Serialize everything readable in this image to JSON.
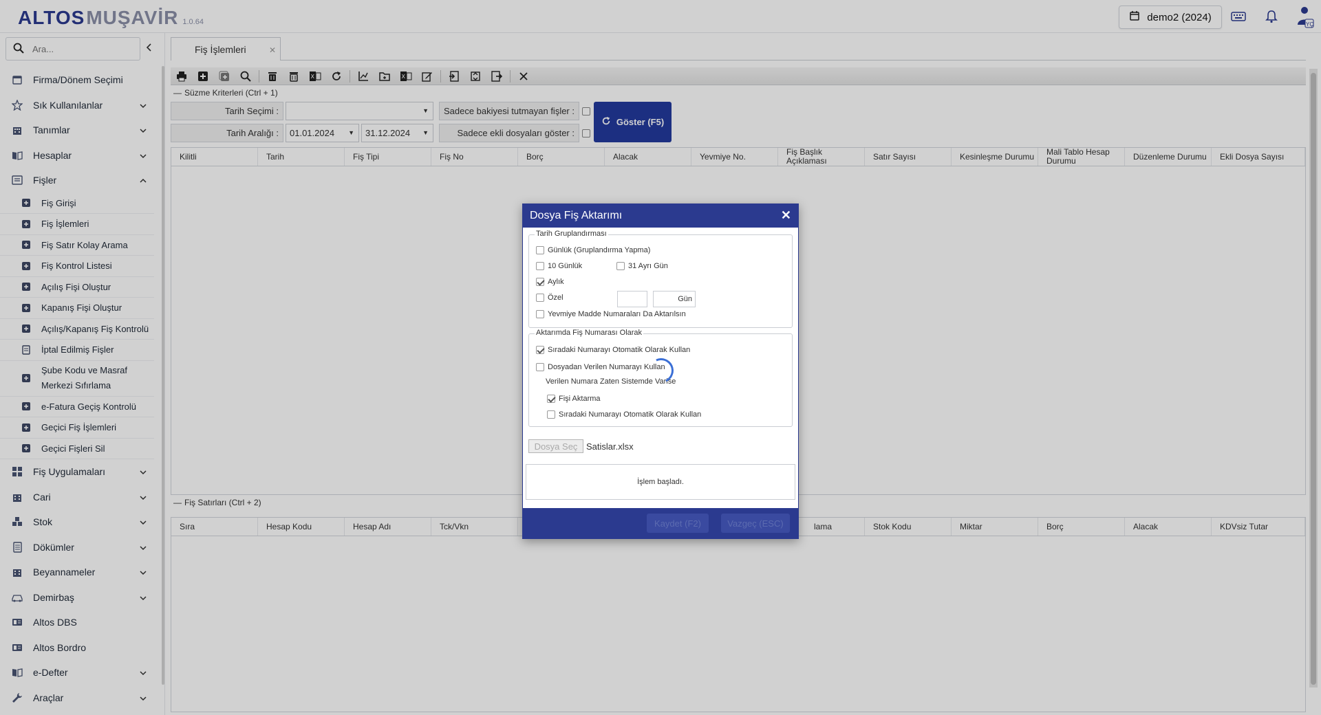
{
  "app": {
    "logo_part1": "ALTOS",
    "logo_part2": "MUŞAVİR",
    "version": "1.0.64",
    "company": "demo2 (2024)",
    "user_initials": "YÇ"
  },
  "sidebar": {
    "search_placeholder": "Ara...",
    "items": [
      {
        "label": "Firma/Dönem Seçimi",
        "icon": "calendar-icon"
      },
      {
        "label": "Sık Kullanılanlar",
        "icon": "star-icon"
      },
      {
        "label": "Tanımlar",
        "icon": "building-icon"
      },
      {
        "label": "Hesaplar",
        "icon": "book-icon"
      },
      {
        "label": "Fişler",
        "icon": "list-icon"
      }
    ],
    "sub_items": [
      "Fiş Girişi",
      "Fiş İşlemleri",
      "Fiş Satır Kolay Arama",
      "Fiş Kontrol Listesi",
      "Açılış Fişi Oluştur",
      "Kapanış Fişi Oluştur",
      "Açılış/Kapanış Fiş Kontrolü",
      "İptal Edilmiş Fişler",
      "Şube Kodu ve Masraf Merkezi Sıfırlama",
      "e-Fatura Geçiş Kontrolü",
      "Geçici Fiş İşlemleri",
      "Geçici Fişleri Sil"
    ],
    "bottom_items": [
      {
        "label": "Fiş Uygulamaları",
        "icon": "grid-icon",
        "chevron": true
      },
      {
        "label": "Cari",
        "icon": "building-icon",
        "chevron": true
      },
      {
        "label": "Stok",
        "icon": "boxes-icon",
        "chevron": true
      },
      {
        "label": "Dökümler",
        "icon": "document-icon",
        "chevron": true
      },
      {
        "label": "Beyannameler",
        "icon": "building-icon",
        "chevron": true
      },
      {
        "label": "Demirbaş",
        "icon": "car-icon",
        "chevron": true
      },
      {
        "label": "Altos DBS",
        "icon": "card-icon",
        "chevron": false
      },
      {
        "label": "Altos Bordro",
        "icon": "card-icon",
        "chevron": false
      },
      {
        "label": "e-Defter",
        "icon": "book-icon",
        "chevron": true
      },
      {
        "label": "Araçlar",
        "icon": "wrench-icon",
        "chevron": true
      }
    ]
  },
  "main": {
    "tab_label": "Fiş İşlemleri",
    "filter_title": "Süzme Kriterleri (Ctrl + 1)",
    "date_select_label": "Tarih Seçimi :",
    "date_select_value": "",
    "date_range_label": "Tarih Aralığı :",
    "date_from": "01.01.2024",
    "date_to": "31.12.2024",
    "unbalanced_label": "Sadece bakiyesi tutmayan fişler :",
    "attached_label": "Sadece ekli dosyaları göster :",
    "show_button": "Göster (F5)",
    "columns": [
      "Kilitli",
      "Tarih",
      "Fiş Tipi",
      "Fiş No",
      "Borç",
      "Alacak",
      "Yevmiye No.",
      "Fiş Başlık Açıklaması",
      "Satır Sayısı",
      "Kesinleşme Durumu",
      "Mali Tablo Hesap Durumu",
      "Düzenleme Durumu",
      "Ekli Dosya Sayısı"
    ],
    "lines_title": "Fiş Satırları (Ctrl + 2)",
    "line_columns": [
      "Sıra",
      "Hesap Kodu",
      "Hesap Adı",
      "Tck/Vkn",
      "",
      "",
      "",
      "",
      "Stok Kodu",
      "Miktar",
      "Borç",
      "Alacak",
      "KDVsiz Tutar"
    ],
    "line_partial_label": "lama"
  },
  "dialog": {
    "title": "Dosya Fiş Aktarımı",
    "group1_legend": "Tarih Gruplandırması",
    "opt_daily": "Günlük (Gruplandırma Yapma)",
    "opt_10day": "10 Günlük",
    "opt_31day": "31 Ayrı Gün",
    "opt_monthly": "Aylık",
    "opt_custom": "Özel",
    "custom_value": "",
    "custom_unit": "Gün",
    "opt_journal": "Yevmiye Madde Numaraları Da Aktarılsın",
    "group2_legend": "Aktarımda Fiş Numarası Olarak",
    "opt_next_auto": "Sıradaki Numarayı Otomatik Olarak Kullan",
    "opt_from_file": "Dosyadan Verilen Numarayı Kullan",
    "exists_text": "Verilen Numara Zaten Sistemde Varise",
    "opt_skip": "Fişi Aktarma",
    "opt_next_auto2": "Sıradaki Numarayı Otomatik Olarak Kullan",
    "file_button": "Dosya Seç",
    "file_name": "Satislar.xlsx",
    "status": "İşlem başladı.",
    "save_button": "Kaydet (F2)",
    "cancel_button": "Vazgeç (ESC)",
    "checked": {
      "daily": false,
      "ten": false,
      "thirtyone": false,
      "monthly": true,
      "custom": false,
      "journal": false,
      "next_auto": true,
      "from_file": false,
      "skip": true,
      "next_auto2": false
    }
  },
  "colors": {
    "brand": "#2b3a8f",
    "accent_button": "#233a9e",
    "overlay": "rgba(0,0,0,0.18)"
  }
}
